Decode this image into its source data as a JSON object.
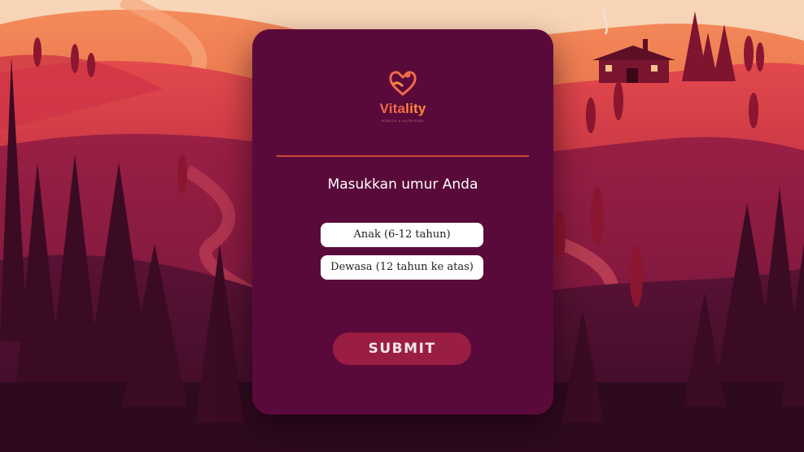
{
  "brand": {
    "logo_text_a": "Vita",
    "logo_text_b": "lity",
    "tagline": "HEALTH & NUTRITION"
  },
  "form": {
    "prompt": "Masukkan umur Anda",
    "options": [
      {
        "label": "Anak (6-12 tahun)"
      },
      {
        "label": "Dewasa (12 tahun ke atas)"
      }
    ],
    "submit_label": "SUBMIT"
  },
  "colors": {
    "card": "#5a0a3a",
    "accent": "#9a1e44",
    "divider": "#c84a3a",
    "logo": "#f06a4a"
  }
}
